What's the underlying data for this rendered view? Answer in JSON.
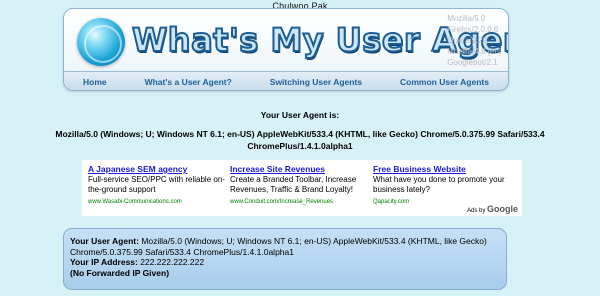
{
  "author": "Chulwoo Pak",
  "header": {
    "title": "What's My User Agent?",
    "user_agents": [
      "Mozilla/5.0",
      "Firefox/2.0.0.6",
      "Opera/9.22",
      "Mozilla/4.8 [en]",
      "Googlebot/2.1"
    ]
  },
  "nav": {
    "home": "Home",
    "whats": "What's a User Agent?",
    "switching": "Switching User Agents",
    "common": "Common User Agents"
  },
  "main": {
    "heading": "Your User Agent is:",
    "user_agent": "Mozilla/5.0 (Windows; U; Windows NT 6.1; en-US) AppleWebKit/533.4 (KHTML, like Gecko) Chrome/5.0.375.99 Safari/533.4 ChromePlus/1.4.1.0alpha1"
  },
  "ads": [
    {
      "title": "A Japanese SEM agency",
      "body": "Full-service SEO/PPC with reliable on-the-ground support",
      "url": "www.Wasabi-Communications.com"
    },
    {
      "title": "Increase Site Revenues",
      "body": "Create a Branded Toolbar, Increase Revenues, Traffic & Brand Loyalty!",
      "url": "www.Conduit.com/Increase_Revenues"
    },
    {
      "title": "Free Business Website",
      "body": "What have you done to promote your business lately?",
      "url": "Qapacity.com"
    }
  ],
  "ads_by": {
    "prefix": "Ads by",
    "brand": "Google"
  },
  "info": {
    "ua_label": "Your User Agent:",
    "ua_value": "Mozilla/5.0 (Windows; U; Windows NT 6.1; en-US) AppleWebKit/533.4 (KHTML, like Gecko) Chrome/5.0.375.99 Safari/533.4 ChromePlus/1.4.1.0alpha1",
    "ip_label": "Your IP Address:",
    "ip_value": "222.222.222.222",
    "forwarded": "(No Forwarded IP Given)"
  }
}
